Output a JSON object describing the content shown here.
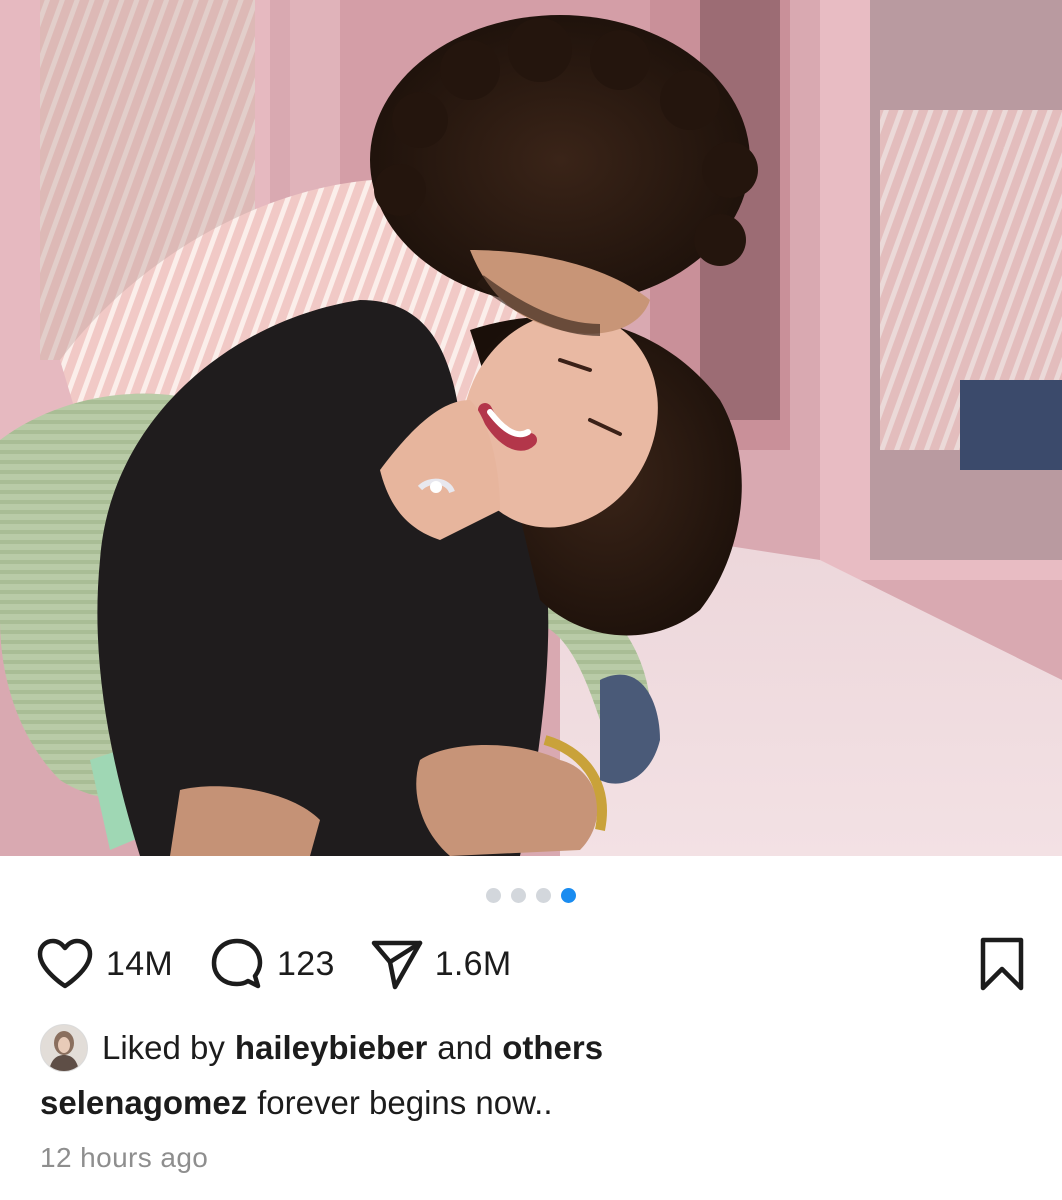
{
  "post": {
    "media": {
      "icon": "photo-image",
      "slide_index": 4,
      "slide_count": 4
    },
    "actions": {
      "likes": "14M",
      "comments": "123",
      "shares": "1.6M"
    },
    "liked_by": {
      "prefix": "Liked by",
      "user": "haileybieber",
      "conjunction": "and",
      "others": "others"
    },
    "caption": {
      "username": "selenagomez",
      "text": "forever begins now.."
    },
    "timestamp": "12 hours ago"
  },
  "colors": {
    "accent_dot": "#1a8cf0",
    "inactive_dot": "#d3d7dc",
    "text": "#1c1c1c",
    "muted": "#8e8e8e"
  }
}
